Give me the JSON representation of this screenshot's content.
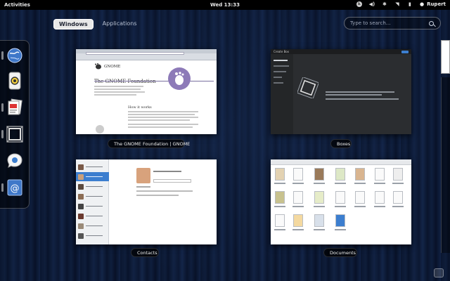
{
  "topbar": {
    "activities_label": "Activities",
    "clock": "Wed 13:33",
    "user_name": "Rupert"
  },
  "view_selector": {
    "windows_label": "Windows",
    "applications_label": "Applications",
    "active": "Windows"
  },
  "search": {
    "placeholder": "Type to search..."
  },
  "dash": {
    "apps": [
      {
        "icon": "web-browser-icon",
        "running": true
      },
      {
        "icon": "gnome-tweak-tool-icon",
        "running": false
      },
      {
        "icon": "documents-icon",
        "running": true
      },
      {
        "icon": "boxes-icon",
        "running": true
      },
      {
        "icon": "empathy-chat-icon",
        "running": false
      },
      {
        "icon": "contacts-icon",
        "running": true
      }
    ]
  },
  "windows": [
    {
      "title": "The GNOME Foundation | GNOME",
      "page_heading": "The GNOME Foundation",
      "section_title": "How it works"
    },
    {
      "title": "Boxes",
      "window_title": "Create Box"
    },
    {
      "title": "Contacts"
    },
    {
      "title": "Documents"
    }
  ],
  "colors": {
    "selection_blue": "#3c7ecf",
    "panel_black": "#000000"
  }
}
